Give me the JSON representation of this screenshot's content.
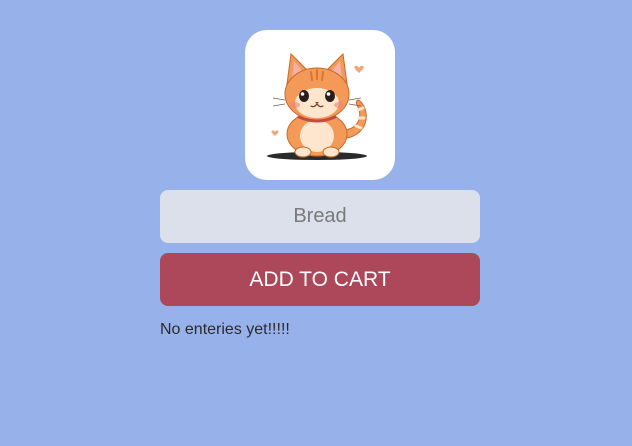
{
  "app": {
    "logo_icon": "cat-mascot-icon",
    "input": {
      "placeholder": "Bread",
      "value": ""
    },
    "add_button_label": "ADD TO CART",
    "empty_message": "No enteries yet!!!!!"
  },
  "colors": {
    "background": "#97b2ea",
    "input_background": "#dce0ea",
    "button_background": "#ac485a",
    "button_text": "#ffffff",
    "cat_orange": "#f39a58"
  }
}
